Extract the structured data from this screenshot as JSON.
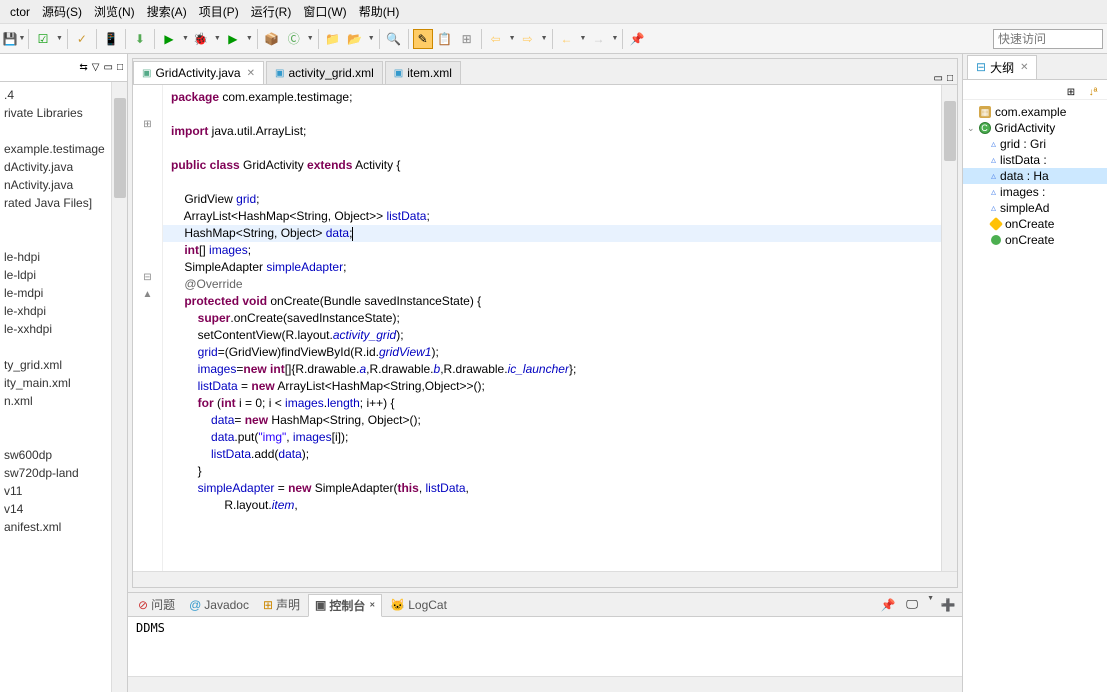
{
  "menu": {
    "refactor": "ctor",
    "source": "源码(S)",
    "browse": "浏览(N)",
    "search": "搜索(A)",
    "project": "项目(P)",
    "run": "运行(R)",
    "window": "窗口(W)",
    "help": "帮助(H)"
  },
  "quickAccess": {
    "placeholder": "快速访问"
  },
  "leftPanel": {
    "items": [
      ".4",
      "rivate Libraries",
      "",
      "example.testimage",
      "dActivity.java",
      "nActivity.java",
      "rated Java Files]",
      "",
      "",
      "le-hdpi",
      "le-ldpi",
      "le-mdpi",
      "le-xhdpi",
      "le-xxhdpi",
      "",
      "ty_grid.xml",
      "ity_main.xml",
      "n.xml",
      "",
      "",
      "sw600dp",
      "sw720dp-land",
      "v11",
      "v14",
      "anifest.xml"
    ]
  },
  "tabs": [
    {
      "label": "GridActivity.java",
      "active": true,
      "icon": "java"
    },
    {
      "label": "activity_grid.xml",
      "active": false,
      "icon": "xml"
    },
    {
      "label": "item.xml",
      "active": false,
      "icon": "xml"
    }
  ],
  "code": {
    "lines": [
      {
        "type": "plain",
        "html": "<span class='kw'>package</span> com.example.testimage;"
      },
      {
        "type": "plain",
        "html": ""
      },
      {
        "type": "plain",
        "html": "<span class='kw'>import</span> java.util.ArrayList;",
        "fold": "+"
      },
      {
        "type": "plain",
        "html": ""
      },
      {
        "type": "plain",
        "html": "<span class='kw'>public class</span> GridActivity <span class='kw'>extends</span> Activity {"
      },
      {
        "type": "plain",
        "html": ""
      },
      {
        "type": "plain",
        "html": "    GridView <span class='field'>grid</span>;"
      },
      {
        "type": "plain",
        "html": "    ArrayList&lt;HashMap&lt;String, Object&gt;&gt; <span class='field'>listData</span>;"
      },
      {
        "type": "highlighted",
        "html": "    HashMap&lt;String, Object&gt; <span class='field'>data</span>;|"
      },
      {
        "type": "plain",
        "html": "    <span class='kw'>int</span>[] <span class='field'>images</span>;"
      },
      {
        "type": "plain",
        "html": "    SimpleAdapter <span class='field'>simpleAdapter</span>;"
      },
      {
        "type": "plain",
        "html": "    <span class='annotation'>@Override</span>",
        "fold": "-"
      },
      {
        "type": "plain",
        "html": "    <span class='kw'>protected void</span> onCreate(Bundle savedInstanceState) {",
        "gutter": "▲"
      },
      {
        "type": "plain",
        "html": "        <span class='kw'>super</span>.onCreate(savedInstanceState);"
      },
      {
        "type": "plain",
        "html": "        setContentView(R.layout.<span class='static-field italic-type'>activity_grid</span>);"
      },
      {
        "type": "plain",
        "html": "        <span class='field'>grid</span>=(GridView)findViewById(R.id.<span class='static-field italic-type'>gridView1</span>);"
      },
      {
        "type": "plain",
        "html": "        <span class='field'>images</span>=<span class='kw'>new int</span>[]{R.drawable.<span class='static-field italic-type'>a</span>,R.drawable.<span class='static-field italic-type'>b</span>,R.drawable.<span class='static-field italic-type'>ic_launcher</span>};"
      },
      {
        "type": "plain",
        "html": "        <span class='field'>listData</span> = <span class='kw'>new</span> ArrayList&lt;HashMap&lt;String,Object&gt;&gt;();"
      },
      {
        "type": "plain",
        "html": "        <span class='kw'>for</span> (<span class='kw'>int</span> i = 0; i &lt; <span class='field'>images</span>.<span class='field'>length</span>; i++) {"
      },
      {
        "type": "plain",
        "html": "            <span class='field'>data</span>= <span class='kw'>new</span> HashMap&lt;String, Object&gt;();"
      },
      {
        "type": "plain",
        "html": "            <span class='field'>data</span>.put(<span class='str'>\"img\"</span>, <span class='field'>images</span>[i]);"
      },
      {
        "type": "plain",
        "html": "            <span class='field'>listData</span>.add(<span class='field'>data</span>);"
      },
      {
        "type": "plain",
        "html": "        }"
      },
      {
        "type": "plain",
        "html": "        <span class='field'>simpleAdapter</span> = <span class='kw'>new</span> SimpleAdapter(<span class='kw'>this</span>, <span class='field'>listData</span>,"
      },
      {
        "type": "plain",
        "html": "                R.layout.<span class='static-field italic-type'>item</span>,"
      }
    ]
  },
  "bottomTabs": {
    "problems": "问题",
    "javadoc": "Javadoc",
    "declaration": "声明",
    "console": "控制台",
    "logcat": "LogCat"
  },
  "bottomContent": "DDMS",
  "outline": {
    "title": "大纲",
    "items": [
      {
        "label": "com.example",
        "icon": "package",
        "indent": 1
      },
      {
        "label": "GridActivity",
        "icon": "class",
        "indent": 0,
        "expand": "v"
      },
      {
        "label": "grid : Gri",
        "icon": "field",
        "indent": 2
      },
      {
        "label": "listData :",
        "icon": "field",
        "indent": 2
      },
      {
        "label": "data : Ha",
        "icon": "field",
        "indent": 2,
        "selected": true
      },
      {
        "label": "images :",
        "icon": "field",
        "indent": 2
      },
      {
        "label": "simpleAd",
        "icon": "field",
        "indent": 2
      },
      {
        "label": "onCreate",
        "icon": "method-prot",
        "indent": 2
      },
      {
        "label": "onCreate",
        "icon": "method-pub",
        "indent": 2
      }
    ]
  }
}
